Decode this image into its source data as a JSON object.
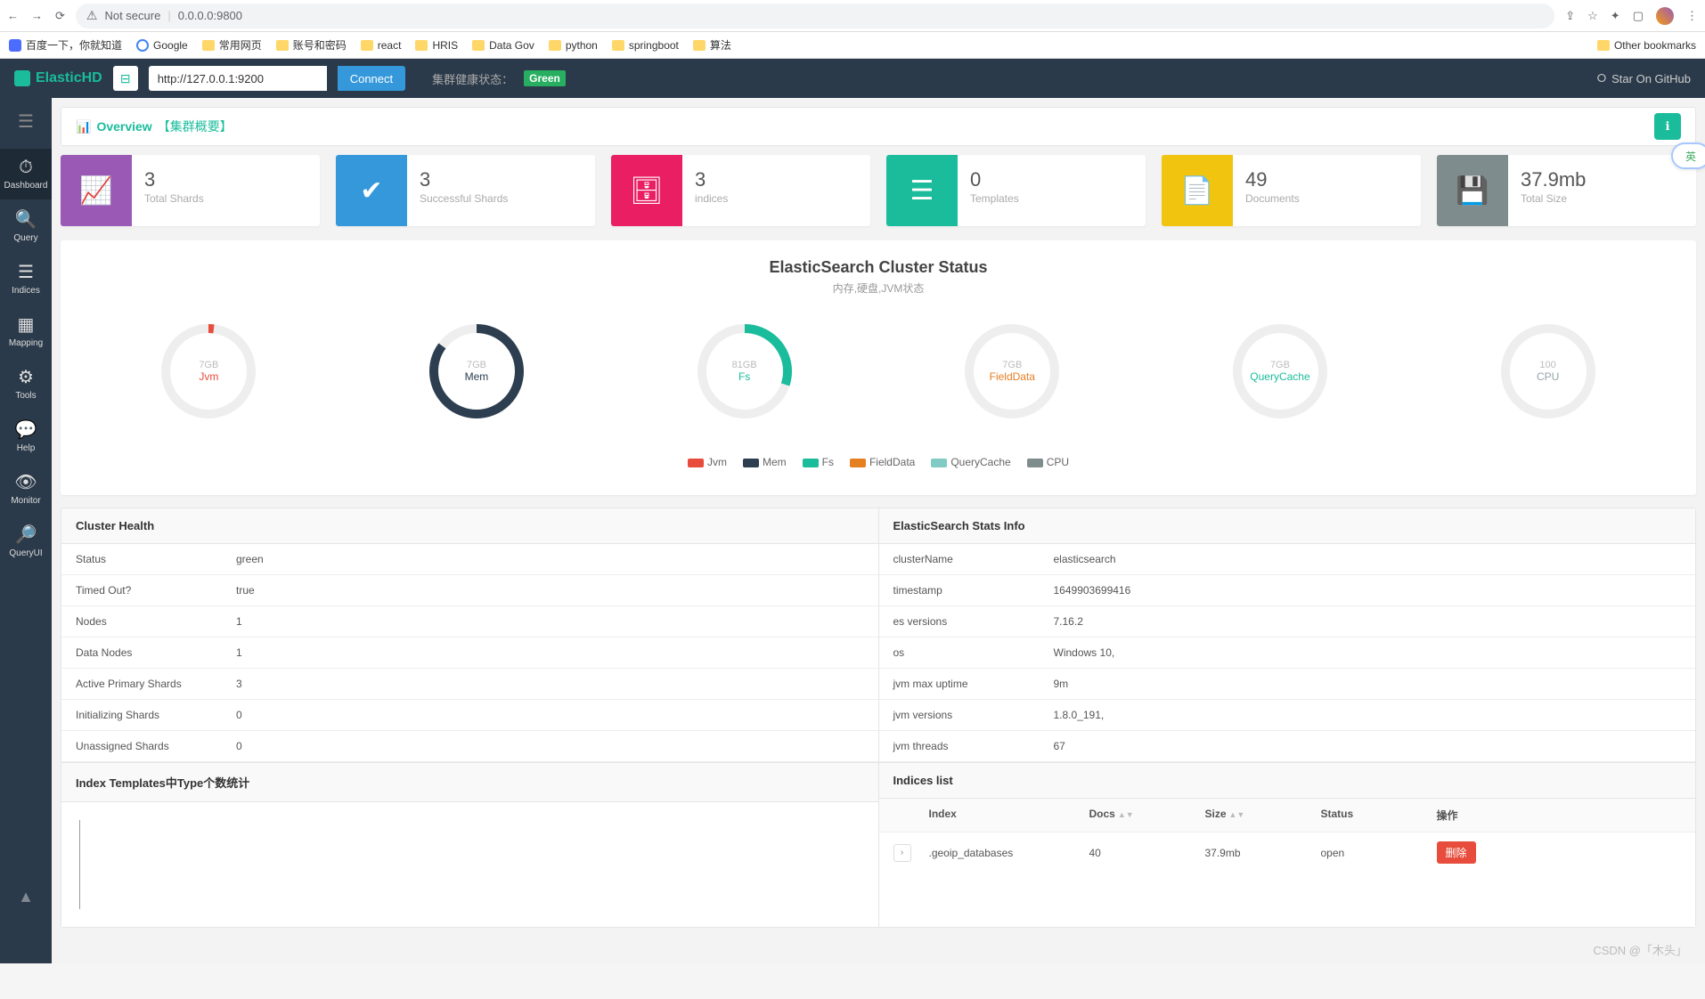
{
  "browser": {
    "address_prefix": "Not secure",
    "address": "0.0.0.0:9800",
    "other_bookmarks": "Other bookmarks",
    "bookmarks": [
      "百度一下，你就知道",
      "Google",
      "常用网页",
      "账号和密码",
      "react",
      "HRIS",
      "Data Gov",
      "python",
      "springboot",
      "算法"
    ]
  },
  "appbar": {
    "logo": "ElasticHD",
    "url_value": "http://127.0.0.1:9200",
    "connect": "Connect",
    "health_label": "集群健康状态：",
    "health_value": "Green",
    "github": "Star On GitHub"
  },
  "sidebar": {
    "items": [
      {
        "label": "Dashboard",
        "icon": "⏱"
      },
      {
        "label": "Query",
        "icon": "🔍"
      },
      {
        "label": "Indices",
        "icon": "☰"
      },
      {
        "label": "Mapping",
        "icon": "▦"
      },
      {
        "label": "Tools",
        "icon": "⚙"
      },
      {
        "label": "Help",
        "icon": "💬"
      },
      {
        "label": "Monitor",
        "icon": "👁"
      },
      {
        "label": "QueryUI",
        "icon": "🔎"
      }
    ]
  },
  "header": {
    "title": "Overview",
    "sub": "【集群概要】"
  },
  "stats": [
    {
      "value": "3",
      "label": "Total Shards",
      "color": "c-purple",
      "icon": "📈"
    },
    {
      "value": "3",
      "label": "Successful Shards",
      "color": "c-blue",
      "icon": "✔"
    },
    {
      "value": "3",
      "label": "indices",
      "color": "c-pink",
      "icon": "🗄"
    },
    {
      "value": "0",
      "label": "Templates",
      "color": "c-teal",
      "icon": "☰"
    },
    {
      "value": "49",
      "label": "Documents",
      "color": "c-yellow",
      "icon": "📄"
    },
    {
      "value": "37.9mb",
      "label": "Total Size",
      "color": "c-gray",
      "icon": "💾"
    }
  ],
  "cluster": {
    "title": "ElasticSearch Cluster Status",
    "sub": "内存,硬盘,JVM状态",
    "gauges": [
      {
        "label": "Jvm",
        "val": "7GB",
        "color": "#e74c3c",
        "percent": 2,
        "labelColor": "#e74c3c"
      },
      {
        "label": "Mem",
        "val": "7GB",
        "color": "#2c3e50",
        "percent": 85,
        "labelColor": "#2c3e50"
      },
      {
        "label": "Fs",
        "val": "81GB",
        "color": "#1abc9c",
        "percent": 30,
        "labelColor": "#1abc9c"
      },
      {
        "label": "FieldData",
        "val": "7GB",
        "color": "#e67e22",
        "percent": 0,
        "labelColor": "#e67e22"
      },
      {
        "label": "QueryCache",
        "val": "7GB",
        "color": "#1abc9c",
        "percent": 0,
        "labelColor": "#1abc9c"
      },
      {
        "label": "CPU",
        "val": "100",
        "color": "#95a5a6",
        "percent": 0,
        "labelColor": "#95a5a6"
      }
    ],
    "legend": [
      {
        "name": "Jvm",
        "color": "#e74c3c"
      },
      {
        "name": "Mem",
        "color": "#2c3e50"
      },
      {
        "name": "Fs",
        "color": "#1abc9c"
      },
      {
        "name": "FieldData",
        "color": "#e67e22"
      },
      {
        "name": "QueryCache",
        "color": "#80cbc4"
      },
      {
        "name": "CPU",
        "color": "#7f8c8d"
      }
    ]
  },
  "health_table": {
    "title": "Cluster Health",
    "rows": [
      {
        "k": "Status",
        "v": "green"
      },
      {
        "k": "Timed Out?",
        "v": "true"
      },
      {
        "k": "Nodes",
        "v": "1"
      },
      {
        "k": "Data Nodes",
        "v": "1"
      },
      {
        "k": "Active Primary Shards",
        "v": "3"
      },
      {
        "k": "Initializing Shards",
        "v": "0"
      },
      {
        "k": "Unassigned Shards",
        "v": "0"
      }
    ]
  },
  "stats_table": {
    "title": "ElasticSearch Stats Info",
    "rows": [
      {
        "k": "clusterName",
        "v": "elasticsearch"
      },
      {
        "k": "timestamp",
        "v": "1649903699416"
      },
      {
        "k": "es versions",
        "v": "7.16.2"
      },
      {
        "k": "os",
        "v": "Windows 10,"
      },
      {
        "k": "jvm max uptime",
        "v": "9m"
      },
      {
        "k": "jvm versions",
        "v": "1.8.0_191,"
      },
      {
        "k": "jvm threads",
        "v": "67"
      }
    ]
  },
  "templates_header": "Index Templates中Type个数统计",
  "indices": {
    "title": "Indices list",
    "headers": {
      "index": "Index",
      "docs": "Docs",
      "size": "Size",
      "status": "Status",
      "act": "操作"
    },
    "rows": [
      {
        "index": ".geoip_databases",
        "docs": "40",
        "size": "37.9mb",
        "status": "open",
        "delete": "删除"
      }
    ]
  },
  "watermark": "CSDN @「木头」",
  "float_badge": "英"
}
